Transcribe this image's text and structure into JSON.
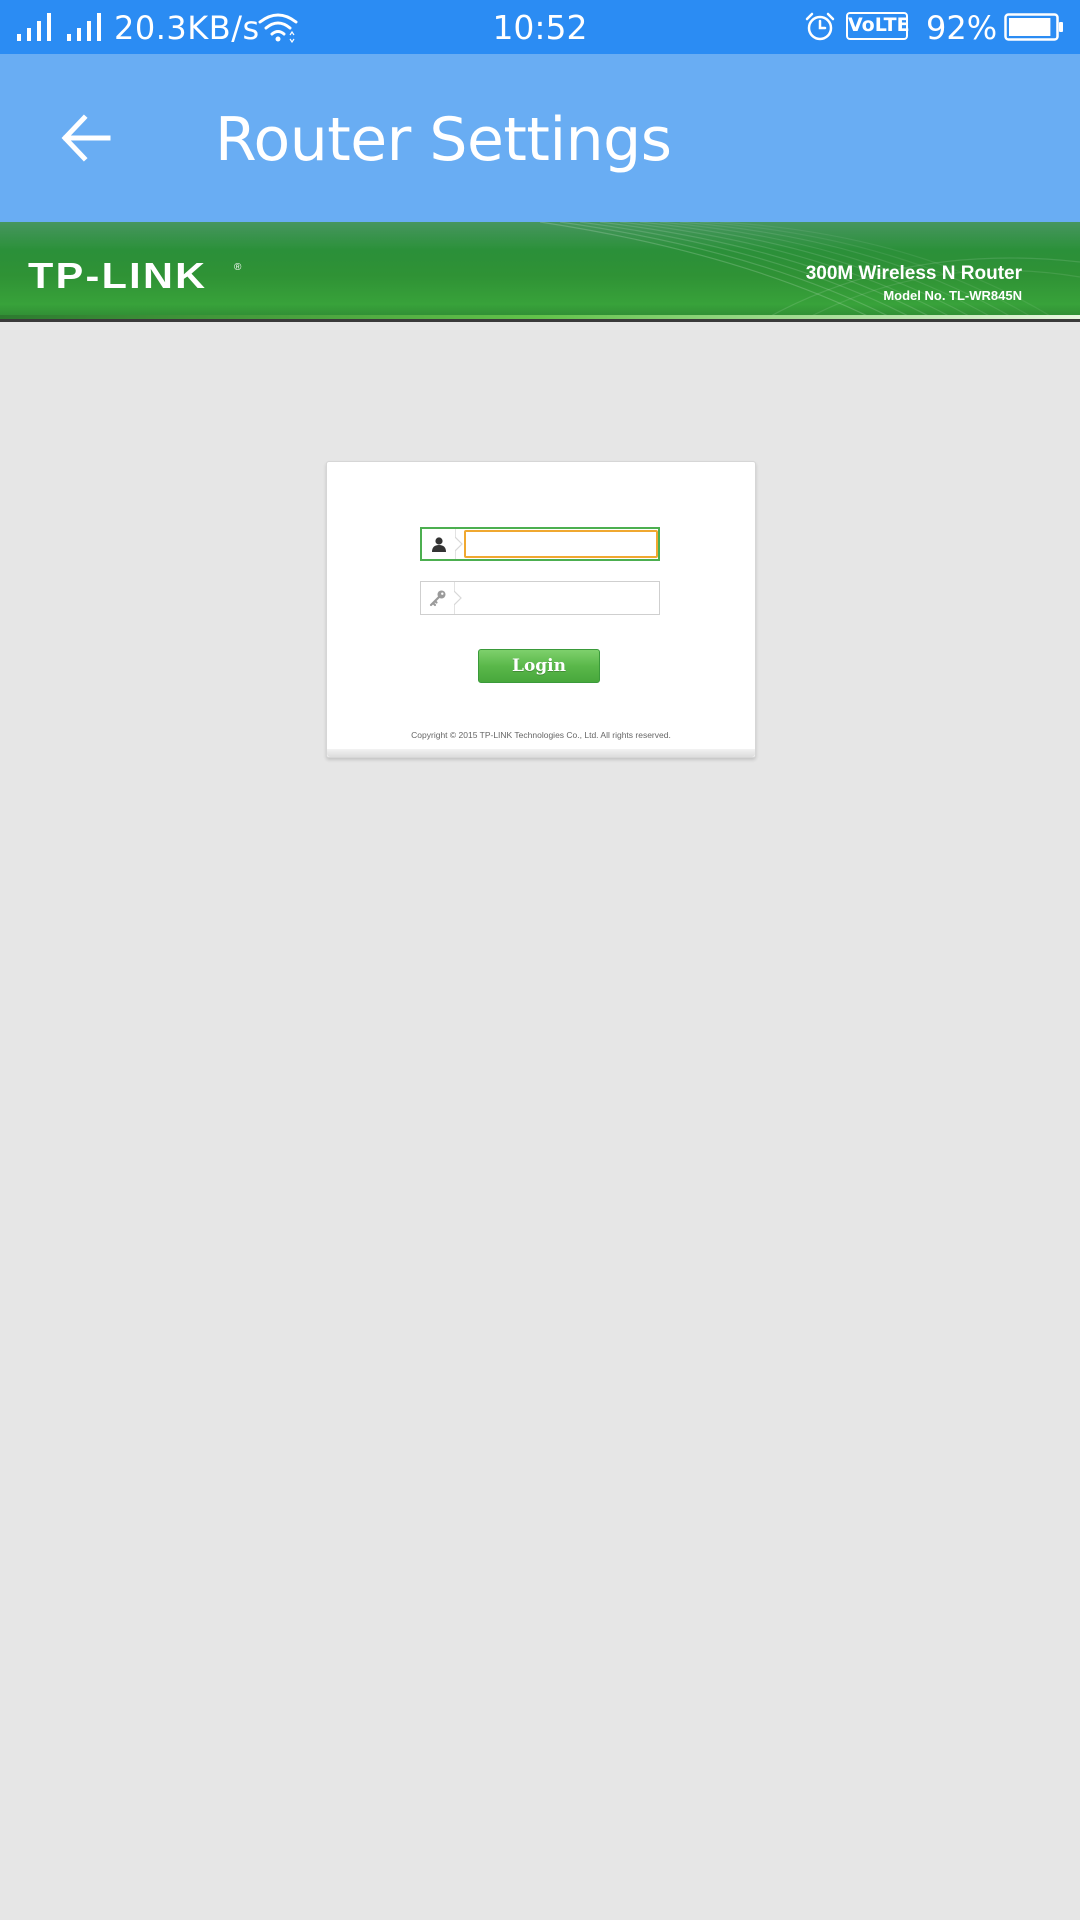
{
  "status_bar": {
    "network_speed": "20.3KB/s",
    "time": "10:52",
    "volte_label": "VoLTE",
    "battery_percent": "92%",
    "battery_level": 0.92,
    "icons": [
      "signal-icon",
      "signal-icon",
      "wifi-icon",
      "alarm-icon",
      "battery-icon"
    ]
  },
  "app_bar": {
    "title": "Router Settings",
    "back_icon": "arrow-left-icon"
  },
  "banner": {
    "logo": "TP-LINK",
    "logo_mark": "®",
    "product": "300M Wireless N Router",
    "model": "Model No. TL-WR845N"
  },
  "login": {
    "username_value": "",
    "username_icon": "user-icon",
    "password_value": "",
    "password_icon": "key-icon",
    "button_label": "Login",
    "copyright": "Copyright © 2015 TP-LINK Technologies Co., Ltd. All rights reserved."
  },
  "colors": {
    "status_bar": "#2b8cf3",
    "app_bar": "#69adf3",
    "page_background": "#e6e6e6",
    "banner_green": "#2f9235",
    "active_field_border": "#4caf50",
    "focus_ring": "#f0a830",
    "login_button": "#5ab84a"
  }
}
